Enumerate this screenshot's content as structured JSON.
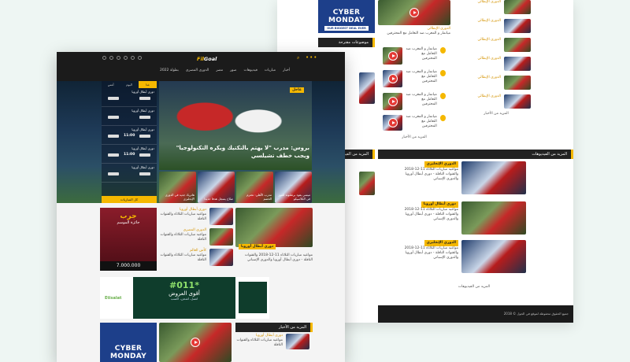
{
  "back_page": {
    "cyber_ad": {
      "title": "CYBER MONDAY",
      "subtitle": "OUR BIGGEST DEAL EVER"
    },
    "topics_heading": "موضوعات مقترحة",
    "tag": "الدوري الإيطالي",
    "list_text": "ميانمار و المغرب ضد التعامل مع المحترفين",
    "more_latest": "المزيد من الأخبار",
    "more_videos": "المزيد من الفيديوهات",
    "videos_heading": "المزيد من الفيديوهات",
    "videos": [
      {
        "tag": "الدوري الإنجليزي",
        "text": "مواعيد مباريات الثلاثاء 11-12-2018 والقنوات الناقلة - دوري أبطال أوروبا والدوري الإسباني"
      },
      {
        "tag": "دوري أبطال أوروبا",
        "text": "مواعيد مباريات الثلاثاء 11-12-2018 والقنوات الناقلة - دوري أبطال أوروبا والدوري الإسباني"
      },
      {
        "tag": "الدوري الإنجليزي",
        "text": "مواعيد مباريات الثلاثاء 11-12-2018 والقنوات الناقلة - دوري أبطال أوروبا والدوري الإسباني"
      }
    ],
    "more_recent": "المزيد من الأخبار",
    "footer_text": "جميع الحقوق محفوظة لموقع في الجول © 2018"
  },
  "front_page": {
    "logo": {
      "prefix": "Fil",
      "suffix": "Goal"
    },
    "nav": [
      "أخبار",
      "مباريات",
      "فيديوهات",
      "صور",
      "مصر",
      "الدوري المصري",
      "بطولة 2022"
    ],
    "hero_tag": "عاجل",
    "hero_title": "بروس: مدرب \"لا يهتم بالتكتيك ويكره التكنولوجيا\" ويجب خطف تشيلسي",
    "sub_thumbs": [
      "ميسي يقود برشلونة للفوز في الكلاسيكو",
      "مدرب الأهلي: نحترم الخصم",
      "صلاح يسجل هدفا جديدا",
      "هاتريك جديد في الدوري الإنجليزي"
    ],
    "match_tabs": [
      "أمس",
      "اليوم",
      "غدا"
    ],
    "matches": [
      {
        "league": "دوري أبطال أوروبا",
        "time": ""
      },
      {
        "league": "دوري أبطال أوروبا",
        "time": ""
      },
      {
        "league": "دوري أبطال أوروبا",
        "time": "11:00"
      },
      {
        "league": "دوري أبطال أوروبا",
        "time": "11:00"
      },
      {
        "league": "دوري أبطال أوروبا",
        "time": ""
      }
    ],
    "all_matches": "كل المباريات",
    "chocolate_ad": {
      "title": "جرب",
      "subtitle": "جائزة الموسم",
      "amount": "7.000.000"
    },
    "mid_list": [
      {
        "tag": "دوري أبطال أوروبا",
        "text": "مواعيد مباريات الثلاثاء والقنوات الناقلة"
      },
      {
        "tag": "الدوري المصري",
        "text": "مواعيد مباريات الثلاثاء والقنوات الناقلة"
      },
      {
        "tag": "كأس العالم",
        "text": "مواعيد مباريات الثلاثاء والقنوات الناقلة"
      }
    ],
    "mid_feature": {
      "tag": "دوري أبطال أوروبا",
      "text": "مواعيد مباريات الثلاثاء 11-12-2018 والقنوات الناقلة - دوري أبطال أوروبا والدوري الإسباني"
    },
    "etisalat": {
      "big": "#011*",
      "mid": "أقوى العروض",
      "small": "اتصل، اشحن، اكسب",
      "brand": "Etisalat"
    },
    "bottom": {
      "cyber_title": "CYBER MONDAY",
      "heading": "المزيد من الأخبار",
      "tag": "دوري أبطال أوروبا",
      "text": "مواعيد مباريات الثلاثاء والقنوات الناقلة"
    }
  }
}
